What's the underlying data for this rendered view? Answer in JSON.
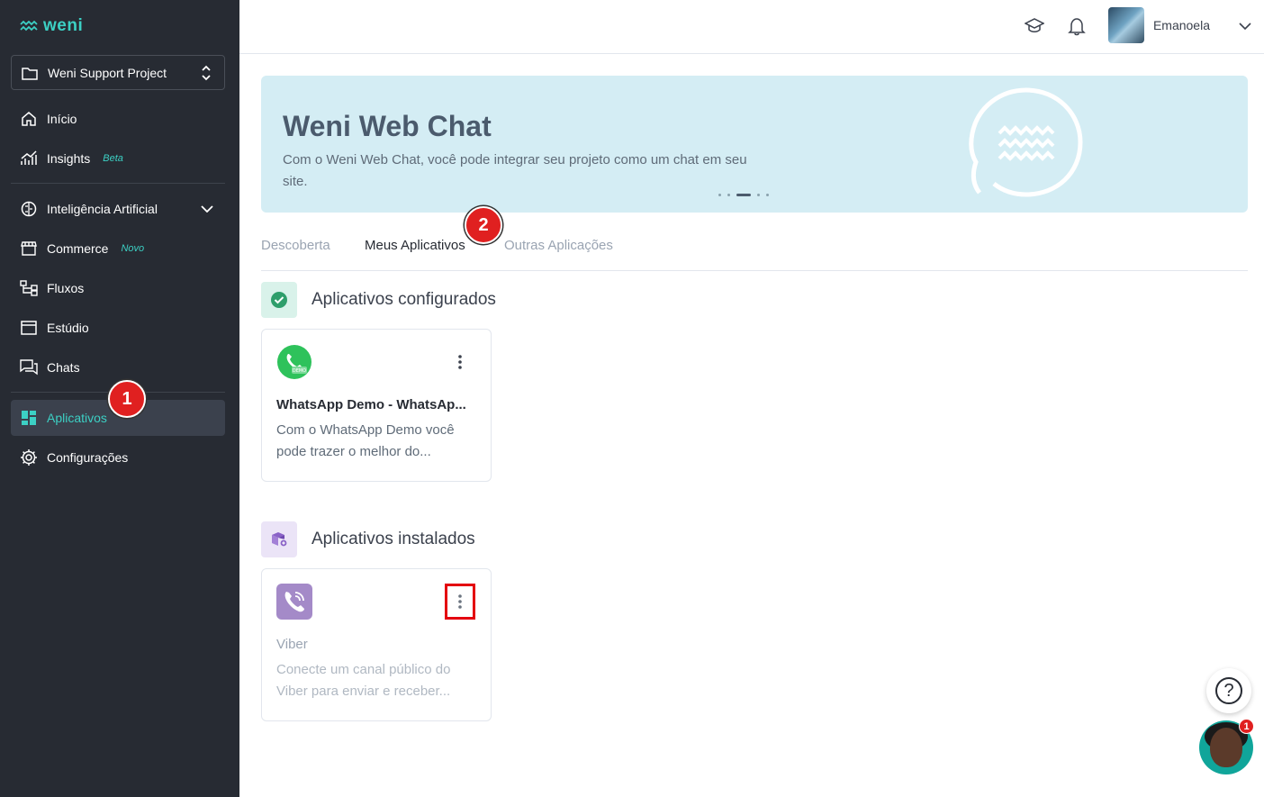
{
  "brand": {
    "logo_text": "weni",
    "accent": "#3cd0c4",
    "sidebar_bg": "#272b33"
  },
  "sidebar": {
    "project": "Weni Support Project",
    "items": [
      {
        "label": "Início",
        "icon": "home-icon"
      },
      {
        "label": "Insights",
        "tag": "Beta",
        "icon": "chart-icon"
      },
      {
        "label": "Inteligência Artificial",
        "icon": "brain-icon"
      },
      {
        "label": "Commerce",
        "tag": "Novo",
        "icon": "store-icon"
      },
      {
        "label": "Fluxos",
        "icon": "flow-icon"
      },
      {
        "label": "Estúdio",
        "icon": "studio-icon"
      },
      {
        "label": "Chats",
        "icon": "chats-icon"
      },
      {
        "label": "Aplicativos",
        "icon": "apps-icon",
        "active": true
      },
      {
        "label": "Configurações",
        "icon": "gear-icon"
      }
    ]
  },
  "topbar": {
    "user_name": "Emanoela"
  },
  "banner": {
    "title": "Weni Web Chat",
    "description": "Com o Weni Web Chat, você pode integrar seu projeto como um chat em seu site.",
    "bg": "#d4edf4"
  },
  "tabs": [
    {
      "label": "Descoberta",
      "active": false
    },
    {
      "label": "Meus Aplicativos",
      "active": true
    },
    {
      "label": "Outras Aplicações",
      "active": false
    }
  ],
  "markers": {
    "m1": "1",
    "m2": "2"
  },
  "sections": {
    "configured": {
      "title": "Aplicativos configurados",
      "cards": [
        {
          "title": "WhatsApp Demo - WhatsAp...",
          "description": "Com o WhatsApp Demo você pode trazer o melhor do..."
        }
      ]
    },
    "installed": {
      "title": "Aplicativos instalados",
      "cards": [
        {
          "title": "Viber",
          "description": "Conecte um canal público do Viber para enviar e receber..."
        }
      ]
    }
  },
  "floating": {
    "help_label": "?",
    "chat_badge": "1"
  }
}
